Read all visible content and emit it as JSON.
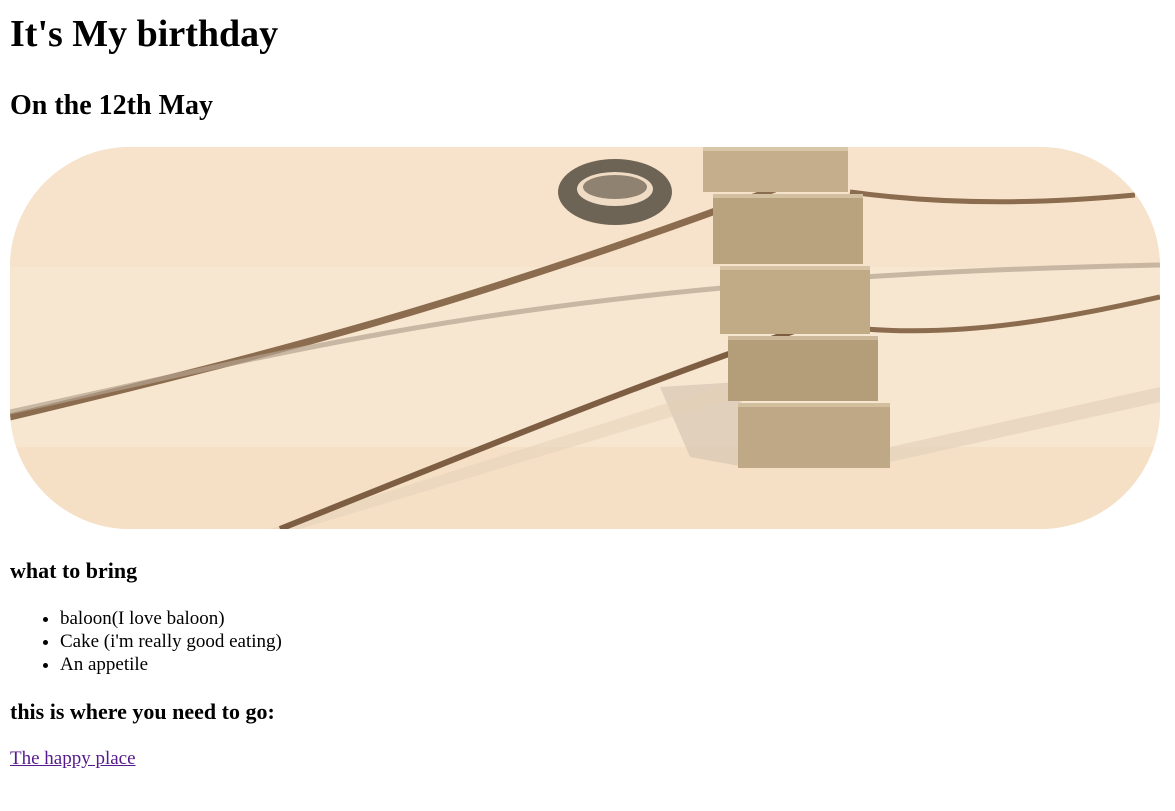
{
  "heading": "It's My birthday",
  "subheading": "On the 12th May",
  "hero_image": {
    "icon": "photo-sand-post-ropes-tire"
  },
  "bring": {
    "heading": "what to bring",
    "items": [
      "baloon(I love baloon)",
      "Cake (i'm really good eating)",
      "An appetile"
    ]
  },
  "location": {
    "heading": "this is where you need to go:",
    "link_label": "The happy place"
  },
  "colors": {
    "link": "#551a8b",
    "sand": "#f6e4cd",
    "post": "#b9a37f",
    "rope": "#8c6c4e"
  }
}
